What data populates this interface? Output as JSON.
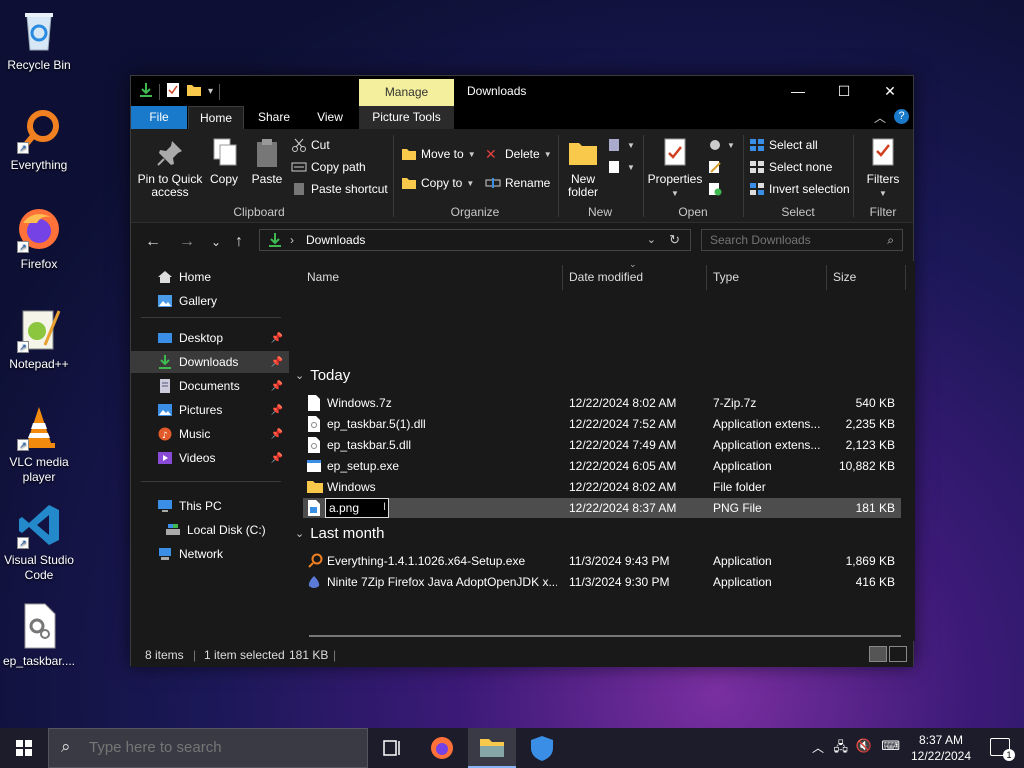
{
  "desktop": {
    "icons": [
      {
        "label": "Recycle Bin"
      },
      {
        "label": "Everything"
      },
      {
        "label": "Firefox"
      },
      {
        "label": "Notepad++"
      },
      {
        "label": "VLC media player"
      },
      {
        "label": "Visual Studio Code"
      },
      {
        "label": "ep_taskbar...."
      }
    ]
  },
  "window": {
    "title": "Downloads",
    "manage_tab": "Manage",
    "tabs": {
      "file": "File",
      "home": "Home",
      "share": "Share",
      "view": "View",
      "picture_tools": "Picture Tools"
    }
  },
  "ribbon": {
    "clipboard": {
      "pin": "Pin to Quick access",
      "copy": "Copy",
      "paste": "Paste",
      "cut": "Cut",
      "copy_path": "Copy path",
      "paste_shortcut": "Paste shortcut",
      "group": "Clipboard"
    },
    "organize": {
      "move_to": "Move to",
      "copy_to": "Copy to",
      "delete": "Delete",
      "rename": "Rename",
      "group": "Organize"
    },
    "new": {
      "new_folder": "New folder",
      "group": "New"
    },
    "open": {
      "properties": "Properties",
      "group": "Open"
    },
    "select": {
      "select_all": "Select all",
      "select_none": "Select none",
      "invert": "Invert selection",
      "group": "Select"
    },
    "filter": {
      "filters": "Filters",
      "group": "Filter"
    }
  },
  "address": {
    "path": "Downloads",
    "search_placeholder": "Search Downloads"
  },
  "navpane": {
    "home": "Home",
    "gallery": "Gallery",
    "desktop": "Desktop",
    "downloads": "Downloads",
    "documents": "Documents",
    "pictures": "Pictures",
    "music": "Music",
    "videos": "Videos",
    "this_pc": "This PC",
    "local_disk": "Local Disk (C:)",
    "network": "Network"
  },
  "columns": {
    "name": "Name",
    "date": "Date modified",
    "type": "Type",
    "size": "Size"
  },
  "groups": {
    "today": "Today",
    "last_month": "Last month"
  },
  "files_today": [
    {
      "name": "Windows.7z",
      "date": "12/22/2024 8:02 AM",
      "type": "7-Zip.7z",
      "size": "540 KB"
    },
    {
      "name": "ep_taskbar.5(1).dll",
      "date": "12/22/2024 7:52 AM",
      "type": "Application extens...",
      "size": "2,235 KB"
    },
    {
      "name": "ep_taskbar.5.dll",
      "date": "12/22/2024 7:49 AM",
      "type": "Application extens...",
      "size": "2,123 KB"
    },
    {
      "name": "ep_setup.exe",
      "date": "12/22/2024 6:05 AM",
      "type": "Application",
      "size": "10,882 KB"
    },
    {
      "name": "Windows",
      "date": "12/22/2024 8:02 AM",
      "type": "File folder",
      "size": ""
    },
    {
      "name": "a.png",
      "date": "12/22/2024 8:37 AM",
      "type": "PNG File",
      "size": "181 KB"
    }
  ],
  "files_last_month": [
    {
      "name": "Everything-1.4.1.1026.x64-Setup.exe",
      "date": "11/3/2024 9:43 PM",
      "type": "Application",
      "size": "1,869 KB"
    },
    {
      "name": "Ninite 7Zip Firefox Java AdoptOpenJDK x...",
      "date": "11/3/2024 9:30 PM",
      "type": "Application",
      "size": "416 KB"
    }
  ],
  "status": {
    "items": "8 items",
    "selected": "1 item selected",
    "sel_size": "181 KB"
  },
  "taskbar": {
    "search_placeholder": "Type here to search",
    "time": "8:37 AM",
    "date": "12/22/2024",
    "notif_count": "1"
  }
}
